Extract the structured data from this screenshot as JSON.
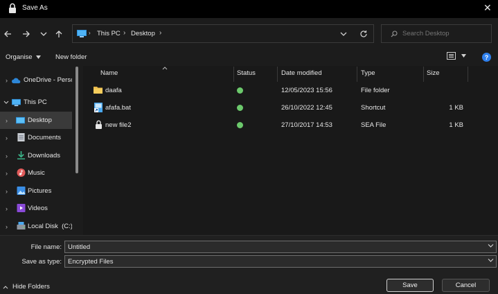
{
  "window": {
    "title": "Save As",
    "close_glyph": "✕"
  },
  "nav": {
    "path_root": "This PC",
    "path_folder": "Desktop",
    "search_placeholder": "Search Desktop"
  },
  "toolbar": {
    "organise_label": "Organise",
    "new_folder_label": "New folder"
  },
  "sidebar": {
    "items": [
      {
        "label": "OneDrive - Perso",
        "icon": "cloud-icon"
      },
      {
        "label": "This PC",
        "icon": "pc-icon"
      },
      {
        "label": "Desktop",
        "icon": "desktop-icon"
      },
      {
        "label": "Documents",
        "icon": "documents-icon"
      },
      {
        "label": "Downloads",
        "icon": "downloads-icon"
      },
      {
        "label": "Music",
        "icon": "music-icon"
      },
      {
        "label": "Pictures",
        "icon": "pictures-icon"
      },
      {
        "label": "Videos",
        "icon": "videos-icon"
      },
      {
        "label": "Local Disk  (C:)",
        "icon": "disk-icon"
      }
    ]
  },
  "columns": {
    "name": "Name",
    "status": "Status",
    "date": "Date modified",
    "type": "Type",
    "size": "Size"
  },
  "files": [
    {
      "name": "daafa",
      "date": "12/05/2023 15:56",
      "type": "File folder",
      "size": "",
      "icon": "folder-icon"
    },
    {
      "name": "afafa.bat",
      "date": "26/10/2022 12:45",
      "type": "Shortcut",
      "size": "1 KB",
      "icon": "shortcut-icon"
    },
    {
      "name": "new file2",
      "date": "27/10/2017 14:53",
      "type": "SEA File",
      "size": "1 KB",
      "icon": "lock-file-icon"
    }
  ],
  "bottom": {
    "file_name_label": "File name:",
    "file_name_value": "Untitled",
    "save_type_label": "Save as type:",
    "save_type_value": "Encrypted Files",
    "hide_folders_label": "Hide Folders",
    "save_label": "Save",
    "cancel_label": "Cancel"
  },
  "colors": {
    "status_ok": "#6cc96c",
    "accent": "#3f9ae5",
    "help": "#2f80ed"
  }
}
